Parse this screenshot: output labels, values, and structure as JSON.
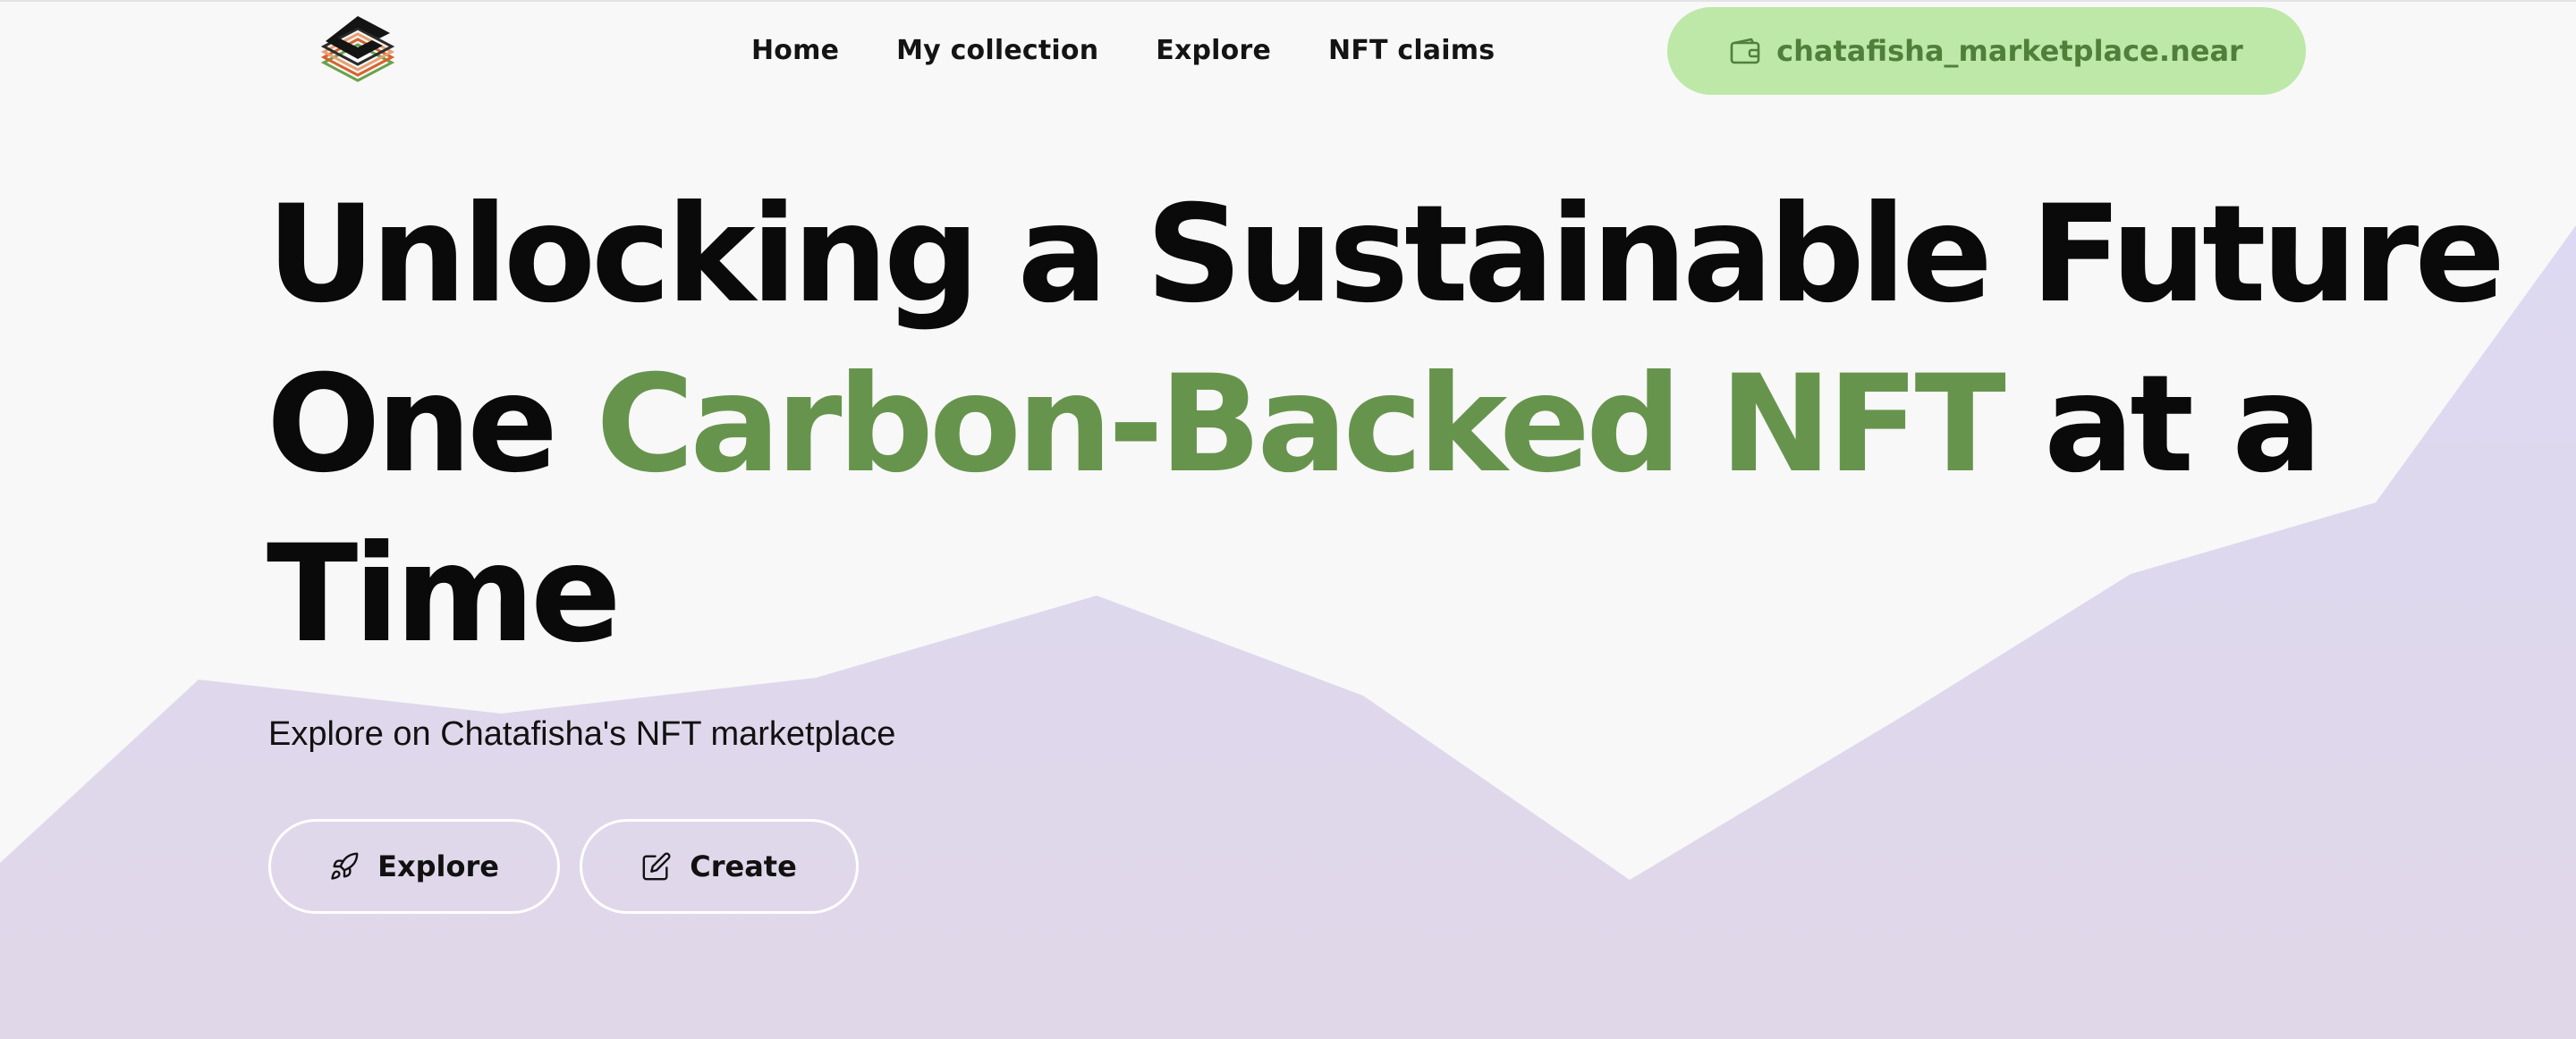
{
  "nav": {
    "logo": "logo-icon",
    "links": [
      {
        "label": "Home"
      },
      {
        "label": "My collection"
      },
      {
        "label": "Explore"
      },
      {
        "label": "NFT claims"
      }
    ],
    "wallet": {
      "icon": "wallet-icon",
      "label": "chatafisha_marketplace.near"
    }
  },
  "hero": {
    "headline": {
      "line1": "Unlocking a Sustainable Future",
      "line2_prefix": "One ",
      "line2_accent": "Carbon-Backed NFT",
      "line2_suffix": " at a",
      "line3": "Time"
    },
    "subtitle": "Explore on Chatafisha's NFT marketplace",
    "buttons": [
      {
        "label": "Explore",
        "icon": "rocket-icon"
      },
      {
        "label": "Create",
        "icon": "edit-icon"
      }
    ]
  },
  "colors": {
    "accent": "#67944d",
    "wallet_bg": "#bde8a8",
    "wallet_text": "#4f7f39",
    "background": "#f8f8f8",
    "shape_fill": "#ded8ef"
  }
}
